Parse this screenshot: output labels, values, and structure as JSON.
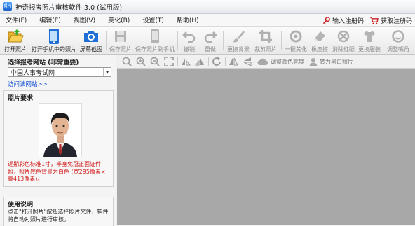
{
  "window": {
    "title": "神奇报考照片审核软件 3.0 (试用版)",
    "app_icon_text": "照片"
  },
  "menu": {
    "items": [
      "文件(F)",
      "编辑(E)",
      "视图(V)",
      "美化(B)",
      "设置(T)",
      "帮助(H)"
    ],
    "register_label": "输入注册码",
    "buy_label": "获取注册码"
  },
  "toolbar": {
    "buttons": [
      {
        "label": "打开照片",
        "icon": "open-folder-icon",
        "enabled": true
      },
      {
        "label": "打开手机中的照片",
        "icon": "phone-icon",
        "enabled": true
      },
      {
        "label": "屏幕截图",
        "icon": "camera-icon",
        "enabled": true
      },
      {
        "label": "保存照片",
        "icon": "save-icon",
        "enabled": false
      },
      {
        "label": "保存照片到手机",
        "icon": "save-to-phone-icon",
        "enabled": false
      },
      {
        "label": "撤销",
        "icon": "undo-icon",
        "enabled": false
      },
      {
        "label": "重做",
        "icon": "redo-icon",
        "enabled": false
      },
      {
        "label": "更换背景",
        "icon": "brush-icon",
        "enabled": false
      },
      {
        "label": "裁剪照片",
        "icon": "crop-icon",
        "enabled": false
      },
      {
        "label": "一键美化",
        "icon": "beautify-icon",
        "enabled": false
      },
      {
        "label": "橡皮擦",
        "icon": "eraser-icon",
        "enabled": false
      },
      {
        "label": "消除红眼",
        "icon": "red-eye-icon",
        "enabled": false
      },
      {
        "label": "更换服装",
        "icon": "clothes-icon",
        "enabled": false
      },
      {
        "label": "调整嘴角",
        "icon": "face-icon",
        "enabled": false
      }
    ]
  },
  "left": {
    "site_title": "选择报考网站 (非常重要)",
    "site_value": "中国人事考试网",
    "visit_link": "访问该网站>>",
    "req_title": "照片要求",
    "req_text": "近期彩色标准1寸，半身免冠正面证件照，照片底色背景为白色 (宽295像素×高413像素)。",
    "usage_title": "使用说明",
    "usage_text": "点击\"打开照片\"按钮选择照片文件，软件将自动对照片进行审核。"
  },
  "canvas_toolbar": {
    "adjust_color_label": "调整颜色亮度",
    "grayscale_label": "转为黑白照片"
  },
  "colors": {
    "accent": "#1a56d6",
    "warning": "#d11a1a",
    "canvas_bg": "#a8a8a8"
  }
}
